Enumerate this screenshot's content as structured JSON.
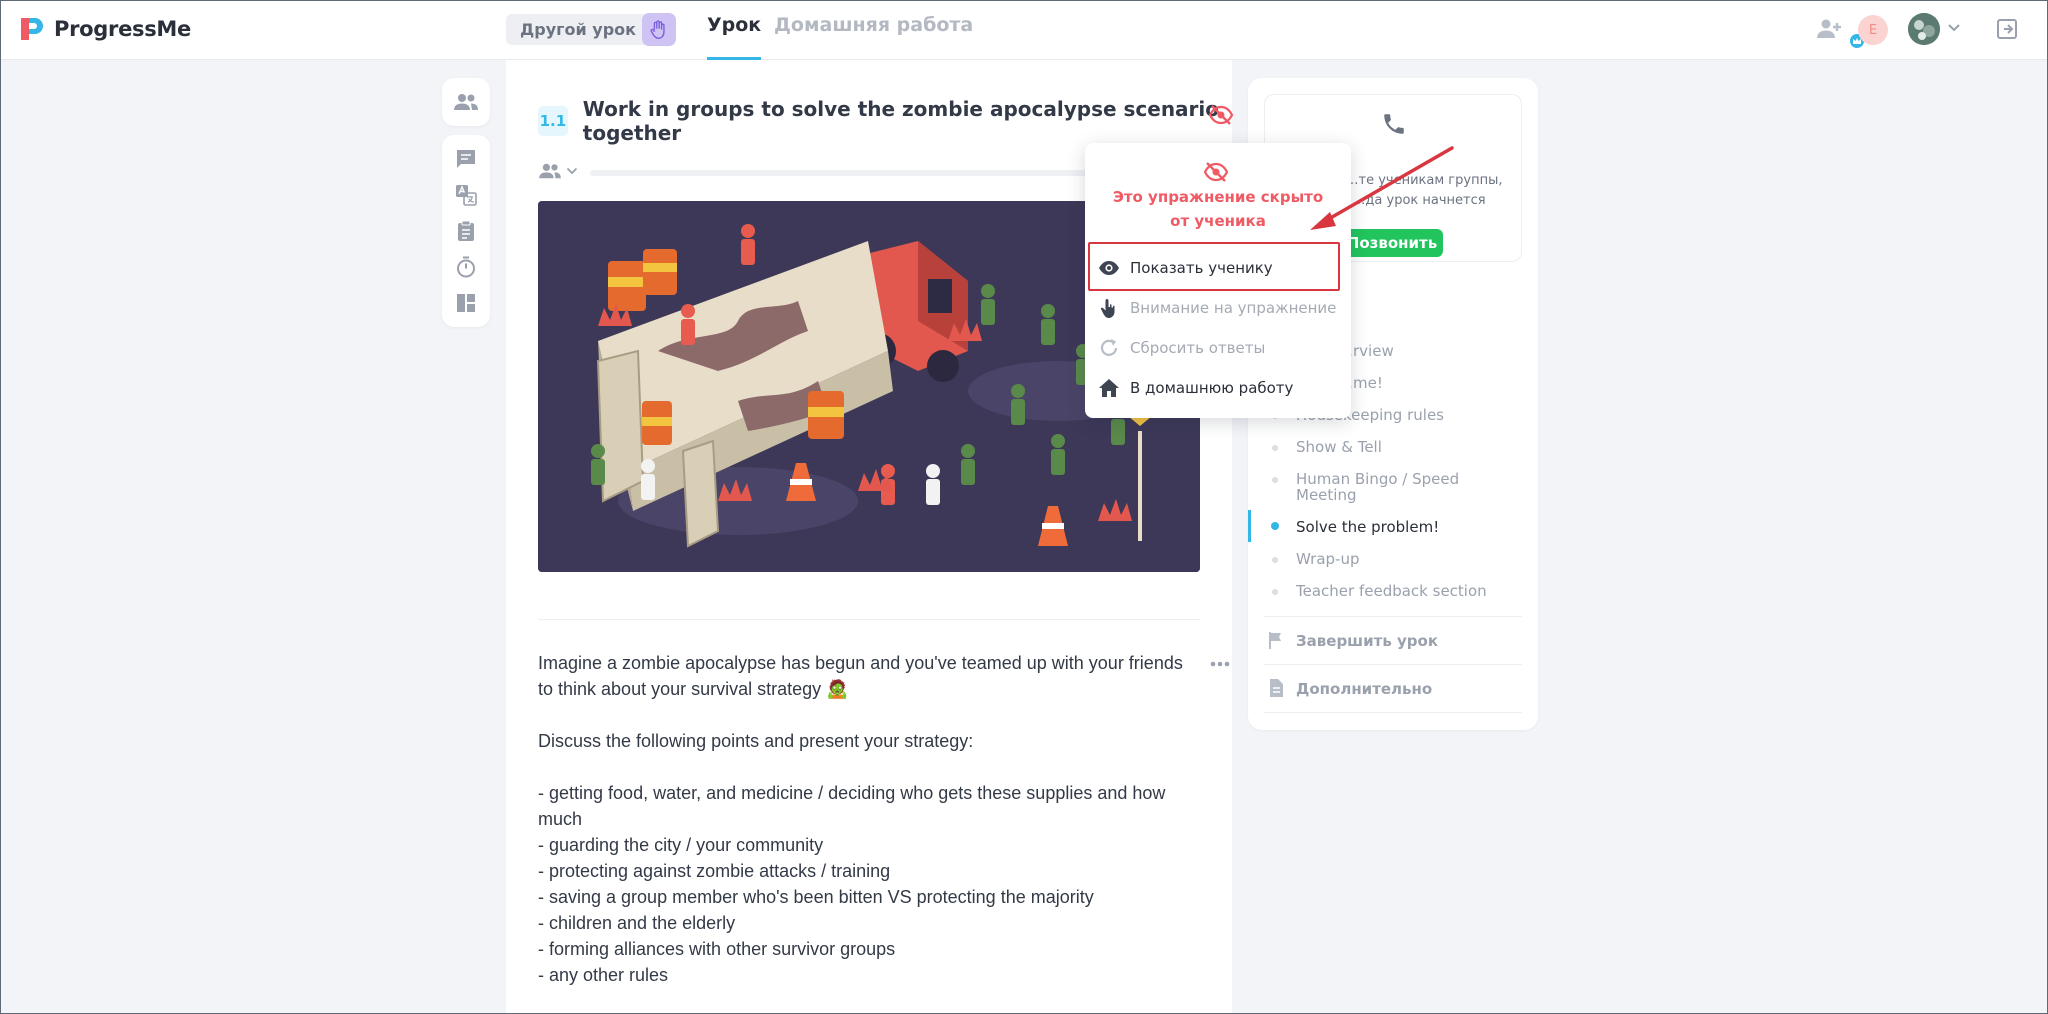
{
  "app": {
    "name": "ProgressMe"
  },
  "header": {
    "other_lesson_label": "Другой урок",
    "tabs": [
      {
        "label": "Урок",
        "active": true
      },
      {
        "label": "Домашняя работа",
        "active": false
      }
    ],
    "avatar_initial": "E"
  },
  "exercise": {
    "number": "1.1",
    "title": "Work in groups to solve the zombie apocalypse scenario together",
    "image_alt": "Isometric illustration of people fighting zombies around an overturned truck",
    "body": {
      "intro": "Imagine a zombie apocalypse has begun and you've teamed up with your friends to think about your survival strategy 🧟",
      "prompt": "Discuss the following points and present your strategy:",
      "points": [
        "- getting food, water, and medicine / deciding who gets these supplies and how much",
        "- guarding the city / your community",
        "- protecting against zombie attacks / training",
        "- saving a group member who's been bitten VS protecting the majority",
        "- children and the elderly",
        "- forming alliances with other survivor groups",
        "- any other rules"
      ]
    }
  },
  "dropdown": {
    "hidden_notice": "Это упражнение скрыто от ученика",
    "items": [
      {
        "label": "Показать ученику",
        "icon": "eye-icon",
        "enabled": true
      },
      {
        "label": "Внимание на упражнение",
        "icon": "pointer-hand-icon",
        "enabled": false
      },
      {
        "label": "Сбросить ответы",
        "icon": "reset-icon",
        "enabled": false
      },
      {
        "label": "В домашнюю работу",
        "icon": "home-icon",
        "enabled": true
      }
    ]
  },
  "right_panel": {
    "call_text_line1": "…те ученикам группы,",
    "call_text_line2": "…да урок начнется",
    "call_button": "Позвонить",
    "plan": [
      {
        "label": "…rview",
        "active": false
      },
      {
        "label": "…me!",
        "active": false
      },
      {
        "label": "Housekeeping rules",
        "active": false
      },
      {
        "label": "Show & Tell",
        "active": false
      },
      {
        "label": "Human Bingo / Speed Meeting",
        "active": false
      },
      {
        "label": "Solve the problem!",
        "active": true
      },
      {
        "label": "Wrap-up",
        "active": false
      },
      {
        "label": "Teacher feedback section",
        "active": false
      }
    ],
    "finish_label": "Завершить урок",
    "extra_label": "Дополнительно"
  },
  "colors": {
    "accent": "#34b7e6",
    "danger": "#ef5a64",
    "success": "#22c45e",
    "highlight_border": "#d8373f"
  }
}
